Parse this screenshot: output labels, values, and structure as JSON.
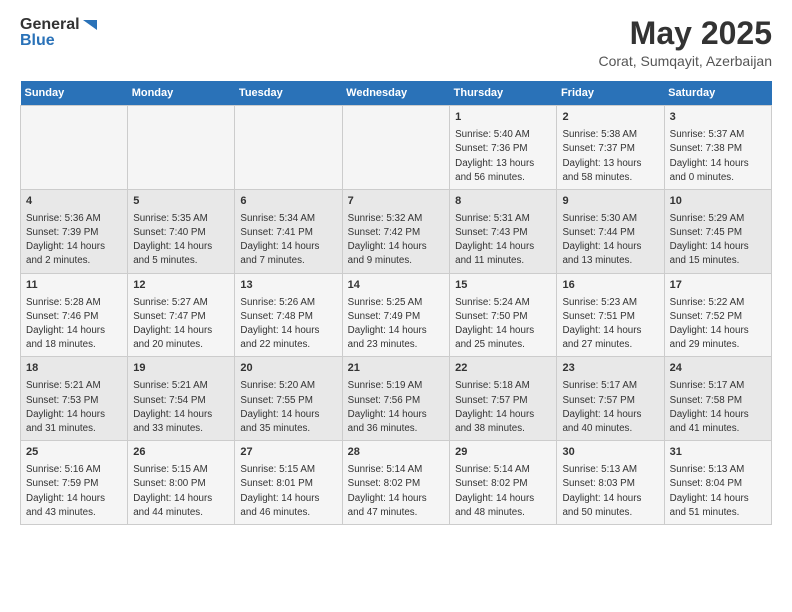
{
  "logo": {
    "general": "General",
    "blue": "Blue"
  },
  "title": "May 2025",
  "subtitle": "Corat, Sumqayit, Azerbaijan",
  "days_header": [
    "Sunday",
    "Monday",
    "Tuesday",
    "Wednesday",
    "Thursday",
    "Friday",
    "Saturday"
  ],
  "weeks": [
    [
      {
        "day": "",
        "sunrise": "",
        "sunset": "",
        "daylight": ""
      },
      {
        "day": "",
        "sunrise": "",
        "sunset": "",
        "daylight": ""
      },
      {
        "day": "",
        "sunrise": "",
        "sunset": "",
        "daylight": ""
      },
      {
        "day": "",
        "sunrise": "",
        "sunset": "",
        "daylight": ""
      },
      {
        "day": "1",
        "sunrise": "Sunrise: 5:40 AM",
        "sunset": "Sunset: 7:36 PM",
        "daylight": "Daylight: 13 hours and 56 minutes."
      },
      {
        "day": "2",
        "sunrise": "Sunrise: 5:38 AM",
        "sunset": "Sunset: 7:37 PM",
        "daylight": "Daylight: 13 hours and 58 minutes."
      },
      {
        "day": "3",
        "sunrise": "Sunrise: 5:37 AM",
        "sunset": "Sunset: 7:38 PM",
        "daylight": "Daylight: 14 hours and 0 minutes."
      }
    ],
    [
      {
        "day": "4",
        "sunrise": "Sunrise: 5:36 AM",
        "sunset": "Sunset: 7:39 PM",
        "daylight": "Daylight: 14 hours and 2 minutes."
      },
      {
        "day": "5",
        "sunrise": "Sunrise: 5:35 AM",
        "sunset": "Sunset: 7:40 PM",
        "daylight": "Daylight: 14 hours and 5 minutes."
      },
      {
        "day": "6",
        "sunrise": "Sunrise: 5:34 AM",
        "sunset": "Sunset: 7:41 PM",
        "daylight": "Daylight: 14 hours and 7 minutes."
      },
      {
        "day": "7",
        "sunrise": "Sunrise: 5:32 AM",
        "sunset": "Sunset: 7:42 PM",
        "daylight": "Daylight: 14 hours and 9 minutes."
      },
      {
        "day": "8",
        "sunrise": "Sunrise: 5:31 AM",
        "sunset": "Sunset: 7:43 PM",
        "daylight": "Daylight: 14 hours and 11 minutes."
      },
      {
        "day": "9",
        "sunrise": "Sunrise: 5:30 AM",
        "sunset": "Sunset: 7:44 PM",
        "daylight": "Daylight: 14 hours and 13 minutes."
      },
      {
        "day": "10",
        "sunrise": "Sunrise: 5:29 AM",
        "sunset": "Sunset: 7:45 PM",
        "daylight": "Daylight: 14 hours and 15 minutes."
      }
    ],
    [
      {
        "day": "11",
        "sunrise": "Sunrise: 5:28 AM",
        "sunset": "Sunset: 7:46 PM",
        "daylight": "Daylight: 14 hours and 18 minutes."
      },
      {
        "day": "12",
        "sunrise": "Sunrise: 5:27 AM",
        "sunset": "Sunset: 7:47 PM",
        "daylight": "Daylight: 14 hours and 20 minutes."
      },
      {
        "day": "13",
        "sunrise": "Sunrise: 5:26 AM",
        "sunset": "Sunset: 7:48 PM",
        "daylight": "Daylight: 14 hours and 22 minutes."
      },
      {
        "day": "14",
        "sunrise": "Sunrise: 5:25 AM",
        "sunset": "Sunset: 7:49 PM",
        "daylight": "Daylight: 14 hours and 23 minutes."
      },
      {
        "day": "15",
        "sunrise": "Sunrise: 5:24 AM",
        "sunset": "Sunset: 7:50 PM",
        "daylight": "Daylight: 14 hours and 25 minutes."
      },
      {
        "day": "16",
        "sunrise": "Sunrise: 5:23 AM",
        "sunset": "Sunset: 7:51 PM",
        "daylight": "Daylight: 14 hours and 27 minutes."
      },
      {
        "day": "17",
        "sunrise": "Sunrise: 5:22 AM",
        "sunset": "Sunset: 7:52 PM",
        "daylight": "Daylight: 14 hours and 29 minutes."
      }
    ],
    [
      {
        "day": "18",
        "sunrise": "Sunrise: 5:21 AM",
        "sunset": "Sunset: 7:53 PM",
        "daylight": "Daylight: 14 hours and 31 minutes."
      },
      {
        "day": "19",
        "sunrise": "Sunrise: 5:21 AM",
        "sunset": "Sunset: 7:54 PM",
        "daylight": "Daylight: 14 hours and 33 minutes."
      },
      {
        "day": "20",
        "sunrise": "Sunrise: 5:20 AM",
        "sunset": "Sunset: 7:55 PM",
        "daylight": "Daylight: 14 hours and 35 minutes."
      },
      {
        "day": "21",
        "sunrise": "Sunrise: 5:19 AM",
        "sunset": "Sunset: 7:56 PM",
        "daylight": "Daylight: 14 hours and 36 minutes."
      },
      {
        "day": "22",
        "sunrise": "Sunrise: 5:18 AM",
        "sunset": "Sunset: 7:57 PM",
        "daylight": "Daylight: 14 hours and 38 minutes."
      },
      {
        "day": "23",
        "sunrise": "Sunrise: 5:17 AM",
        "sunset": "Sunset: 7:57 PM",
        "daylight": "Daylight: 14 hours and 40 minutes."
      },
      {
        "day": "24",
        "sunrise": "Sunrise: 5:17 AM",
        "sunset": "Sunset: 7:58 PM",
        "daylight": "Daylight: 14 hours and 41 minutes."
      }
    ],
    [
      {
        "day": "25",
        "sunrise": "Sunrise: 5:16 AM",
        "sunset": "Sunset: 7:59 PM",
        "daylight": "Daylight: 14 hours and 43 minutes."
      },
      {
        "day": "26",
        "sunrise": "Sunrise: 5:15 AM",
        "sunset": "Sunset: 8:00 PM",
        "daylight": "Daylight: 14 hours and 44 minutes."
      },
      {
        "day": "27",
        "sunrise": "Sunrise: 5:15 AM",
        "sunset": "Sunset: 8:01 PM",
        "daylight": "Daylight: 14 hours and 46 minutes."
      },
      {
        "day": "28",
        "sunrise": "Sunrise: 5:14 AM",
        "sunset": "Sunset: 8:02 PM",
        "daylight": "Daylight: 14 hours and 47 minutes."
      },
      {
        "day": "29",
        "sunrise": "Sunrise: 5:14 AM",
        "sunset": "Sunset: 8:02 PM",
        "daylight": "Daylight: 14 hours and 48 minutes."
      },
      {
        "day": "30",
        "sunrise": "Sunrise: 5:13 AM",
        "sunset": "Sunset: 8:03 PM",
        "daylight": "Daylight: 14 hours and 50 minutes."
      },
      {
        "day": "31",
        "sunrise": "Sunrise: 5:13 AM",
        "sunset": "Sunset: 8:04 PM",
        "daylight": "Daylight: 14 hours and 51 minutes."
      }
    ]
  ]
}
